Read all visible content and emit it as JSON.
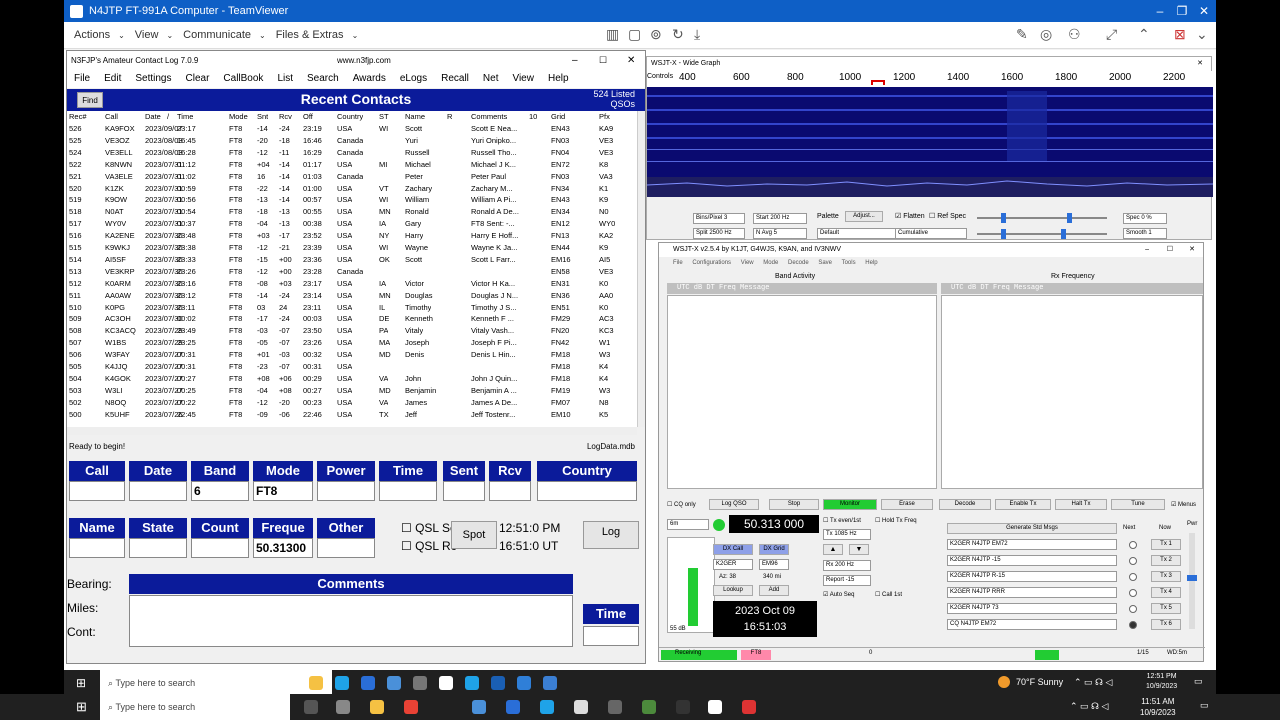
{
  "teamviewer": {
    "title": "N4JTP FT-991A Computer - TeamViewer",
    "menu": [
      "Actions",
      "View",
      "Communicate",
      "Files & Extras"
    ]
  },
  "n3fjp": {
    "title": "N3FJP's Amateur Contact Log 7.0.9",
    "url": "www.n3fjp.com",
    "menu": [
      "File",
      "Edit",
      "Settings",
      "Clear",
      "CallBook",
      "List",
      "Search",
      "Awards",
      "eLogs",
      "Recall",
      "Net",
      "View",
      "Help"
    ],
    "find": "Find",
    "recent_title": "Recent Contacts",
    "listed": "524 Listed",
    "qsos": "QSOs",
    "columns": [
      "Rec#",
      "Call",
      "Date",
      "/",
      "Time",
      "Mode",
      "Snt",
      "Rcv",
      "Off",
      "Country",
      "ST",
      "Name",
      "R",
      "Comments",
      "10",
      "Grid",
      "Pfx"
    ],
    "rows": [
      [
        "526",
        "KA9FOX",
        "2023/09/07",
        "23:17",
        "FT8",
        "-14",
        "-24",
        "23:19",
        "USA",
        "WI",
        "Scott",
        "Scott E Nea...",
        "EN43",
        "KA9"
      ],
      [
        "525",
        "VE3OZ",
        "2023/08/03",
        "16:45",
        "FT8",
        "-20",
        "-18",
        "16:46",
        "Canada",
        "",
        "Yuri",
        "Yuri  Onipko...",
        "FN03",
        "VE3"
      ],
      [
        "524",
        "VE3ELL",
        "2023/08/03",
        "16:28",
        "FT8",
        "-12",
        "-11",
        "16:29",
        "Canada",
        "",
        "Russell",
        "Russell Tho...",
        "FN04",
        "VE3"
      ],
      [
        "522",
        "K8NWN",
        "2023/07/31",
        "01:12",
        "FT8",
        "+04",
        "-14",
        "01:17",
        "USA",
        "MI",
        "Michael",
        "Michael J K...",
        "EN72",
        "K8"
      ],
      [
        "521",
        "VA3ELE",
        "2023/07/31",
        "01:02",
        "FT8",
        "16",
        "-14",
        "01:03",
        "Canada",
        "",
        "Peter",
        "Peter Paul",
        "FN03",
        "VA3"
      ],
      [
        "520",
        "K1ZK",
        "2023/07/31",
        "00:59",
        "FT8",
        "-22",
        "-14",
        "01:00",
        "USA",
        "VT",
        "Zachary",
        "Zachary M...",
        "FN34",
        "K1"
      ],
      [
        "519",
        "K9OW",
        "2023/07/31",
        "00:56",
        "FT8",
        "-13",
        "-14",
        "00:57",
        "USA",
        "WI",
        "William",
        "William A Pi...",
        "EN43",
        "K9"
      ],
      [
        "518",
        "N0AT",
        "2023/07/31",
        "00:54",
        "FT8",
        "-18",
        "-13",
        "00:55",
        "USA",
        "MN",
        "Ronald",
        "Ronald A De...",
        "EN34",
        "N0"
      ],
      [
        "517",
        "WY0V",
        "2023/07/31",
        "00:37",
        "FT8",
        "-04",
        "-13",
        "00:38",
        "USA",
        "IA",
        "Gary",
        "FT8  Sent: -...",
        "EN12",
        "WY0"
      ],
      [
        "516",
        "KA2ENE",
        "2023/07/30",
        "23:48",
        "FT8",
        "+03",
        "-17",
        "23:52",
        "USA",
        "NY",
        "Harry",
        "Harry E Hoff...",
        "FN13",
        "KA2"
      ],
      [
        "515",
        "K9WKJ",
        "2023/07/30",
        "23:38",
        "FT8",
        "-12",
        "-21",
        "23:39",
        "USA",
        "WI",
        "Wayne",
        "Wayne K Ja...",
        "EN44",
        "K9"
      ],
      [
        "514",
        "AI5SF",
        "2023/07/30",
        "23:33",
        "FT8",
        "-15",
        "+00",
        "23:36",
        "USA",
        "OK",
        "Scott",
        "Scott L Farr...",
        "EM16",
        "AI5"
      ],
      [
        "513",
        "VE3KRP",
        "2023/07/30",
        "23:26",
        "FT8",
        "-12",
        "+00",
        "23:28",
        "Canada",
        "",
        "",
        "",
        "EN58",
        "VE3"
      ],
      [
        "512",
        "K0ARM",
        "2023/07/30",
        "23:16",
        "FT8",
        "-08",
        "+03",
        "23:17",
        "USA",
        "IA",
        "Victor",
        "Victor H Ka...",
        "EN31",
        "K0"
      ],
      [
        "511",
        "AA0AW",
        "2023/07/30",
        "23:12",
        "FT8",
        "-14",
        "-24",
        "23:14",
        "USA",
        "MN",
        "Douglas",
        "Douglas J N...",
        "EN36",
        "AA0"
      ],
      [
        "510",
        "K0PG",
        "2023/07/30",
        "23:11",
        "FT8",
        "03",
        "24",
        "23:11",
        "USA",
        "IL",
        "Timothy",
        "Timothy J S...",
        "EN51",
        "K0"
      ],
      [
        "509",
        "AC3OH",
        "2023/07/30",
        "00:02",
        "FT8",
        "-17",
        "-24",
        "00:03",
        "USA",
        "DE",
        "Kenneth",
        "Kenneth F ...",
        "FM29",
        "AC3"
      ],
      [
        "508",
        "KC3ACQ",
        "2023/07/29",
        "23:49",
        "FT8",
        "-03",
        "-07",
        "23:50",
        "USA",
        "PA",
        "Vitaly",
        "Vitaly  Vash...",
        "FN20",
        "KC3"
      ],
      [
        "507",
        "W1BS",
        "2023/07/29",
        "23:25",
        "FT8",
        "-05",
        "-07",
        "23:26",
        "USA",
        "MA",
        "Joseph",
        "Joseph F Pi...",
        "FN42",
        "W1"
      ],
      [
        "506",
        "W3FAY",
        "2023/07/27",
        "00:31",
        "FT8",
        "+01",
        "-03",
        "00:32",
        "USA",
        "MD",
        "Denis",
        "Denis L Hin...",
        "FM18",
        "W3"
      ],
      [
        "505",
        "K4JJQ",
        "2023/07/27",
        "00:31",
        "FT8",
        "-23",
        "-07",
        "00:31",
        "USA",
        "",
        "",
        "",
        "FM18",
        "K4"
      ],
      [
        "504",
        "K4GOK",
        "2023/07/27",
        "00:27",
        "FT8",
        "+08",
        "+06",
        "00:29",
        "USA",
        "VA",
        "John",
        "John J Quin...",
        "FM18",
        "K4"
      ],
      [
        "503",
        "W3LI",
        "2023/07/27",
        "00:25",
        "FT8",
        "-04",
        "+08",
        "00:27",
        "USA",
        "MD",
        "Benjamin",
        "Benjamin A ...",
        "FM19",
        "W3"
      ],
      [
        "502",
        "N8OQ",
        "2023/07/27",
        "00:22",
        "FT8",
        "-12",
        "-20",
        "00:23",
        "USA",
        "VA",
        "James",
        "James A De...",
        "FM07",
        "N8"
      ],
      [
        "500",
        "K5UHF",
        "2023/07/26",
        "22:45",
        "FT8",
        "-09",
        "-06",
        "22:46",
        "USA",
        "TX",
        "Jeff",
        "Jeff  Tostenr...",
        "EM10",
        "K5"
      ]
    ],
    "status_left": "Ready to begin!",
    "status_right": "LogData.mdb",
    "labels": {
      "call": "Call",
      "date": "Date",
      "band": "Band",
      "mode": "Mode",
      "power": "Power",
      "time": "Time",
      "sent": "Sent",
      "rcv": "Rcv",
      "country": "Country",
      "name": "Name",
      "state": "State",
      "count": "Count",
      "freq": "Freque",
      "other": "Other",
      "comments": "Comments",
      "time2": "Time"
    },
    "values": {
      "band": "6",
      "mode": "FT8",
      "freq": "50.31300"
    },
    "qsl_sent": "QSL Se",
    "qsl_rcvd": "QSL Rc",
    "spot": "Spot",
    "time_local": "12:51:0  PM",
    "time_utc": "16:51:0  UT",
    "log": "Log",
    "bearing": "Bearing:",
    "miles": "Miles:",
    "cont": "Cont:"
  },
  "widegraph": {
    "title": "WSJT-X - Wide Graph",
    "scale_label": "Controls",
    "ticks": [
      "400",
      "600",
      "800",
      "1000",
      "1200",
      "1400",
      "1600",
      "1800",
      "2000",
      "2200"
    ],
    "bins": "Bins/Pixel  3",
    "start": "Start 200 Hz",
    "palette": "Palette",
    "adjust": "Adjust...",
    "flatten": "Flatten",
    "refspec": "Ref Spec",
    "spec": "Spec 0 %",
    "split": "Split  2500 Hz",
    "navg": "N Avg  5",
    "default": "Default",
    "cumulative": "Cumulative",
    "smooth": "Smooth  1"
  },
  "wsjtx": {
    "title": "WSJT-X   v2.5.4   by K1JT, G4WJS, K9AN, and IV3NWV",
    "menu": [
      "File",
      "Configurations",
      "View",
      "Mode",
      "Decode",
      "Save",
      "Tools",
      "Help"
    ],
    "band_activity": "Band Activity",
    "rx_frequency": "Rx Frequency",
    "col_header": "UTC   dB   DT Freq    Message",
    "buttons": [
      "CQ only",
      "Log QSO",
      "Stop",
      "Monitor",
      "Erase",
      "Decode",
      "Enable Tx",
      "Halt Tx",
      "Tune",
      "Menus"
    ],
    "band": "6m",
    "dial": "50.313 000",
    "tx_even": "Tx even/1st",
    "hold_tx": "Hold Tx Freq",
    "tx_hz": "Tx 1085 Hz",
    "rx_hz": "Rx  200 Hz",
    "report": "Report  -15",
    "auto_seq": "Auto Seq",
    "call_1st": "Call 1st",
    "dx_call_label": "DX Call",
    "dx_grid_label": "DX Grid",
    "dx_call": "K2GER",
    "dx_grid": "EM96",
    "az": "Az: 38",
    "dist": "340 mi",
    "lookup": "Lookup",
    "add": "Add",
    "date": "2023 Oct 09",
    "time": "16:51:03",
    "db": "55 dB",
    "gen_msgs": "Generate Std Msgs",
    "next": "Next",
    "now": "Now",
    "pwr": "Pwr",
    "messages": [
      "K2GER N4JTP EM72",
      "K2GER N4JTP -15",
      "K2GER N4JTP R-15",
      "K2GER N4JTP RRR",
      "K2GER N4JTP 73",
      "CQ N4JTP EM72"
    ],
    "tx_labels": [
      "Tx 1",
      "Tx 2",
      "Tx 3",
      "Tx 4",
      "Tx 5",
      "Tx 6"
    ],
    "status_receiving": "Receiving",
    "status_mode": "FT8",
    "status_zero": "0",
    "status_count": "1/15",
    "status_wd": "WD:5m"
  },
  "remote_taskbar": {
    "search": "Type here to search",
    "weather": "70°F  Sunny",
    "time": "12:51 PM",
    "date": "10/9/2023"
  },
  "local_taskbar": {
    "search": "Type here to search",
    "time": "11:51 AM",
    "date": "10/9/2023"
  }
}
